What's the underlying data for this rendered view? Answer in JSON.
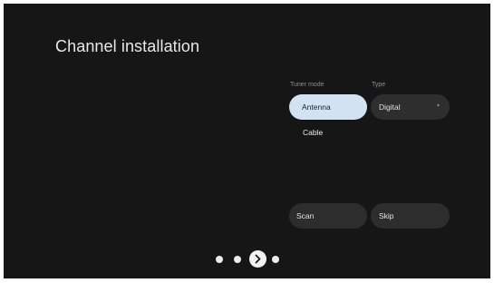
{
  "page": {
    "title": "Channel installation"
  },
  "tuner_mode": {
    "label": "Tuner mode",
    "options": [
      "Antenna",
      "Cable"
    ],
    "selected": "Antenna"
  },
  "type": {
    "label": "Type",
    "value": "Digital",
    "caret_icon": "chevron-down-icon"
  },
  "actions": {
    "scan_label": "Scan",
    "skip_label": "Skip"
  },
  "pager": {
    "total_steps": 4,
    "current_step": 3,
    "next_icon": "chevron-right-icon"
  },
  "colors": {
    "background": "#161616",
    "selected_pill": "#d3e2f2",
    "pill": "#2e2e2e",
    "text": "#e8e8e8"
  }
}
